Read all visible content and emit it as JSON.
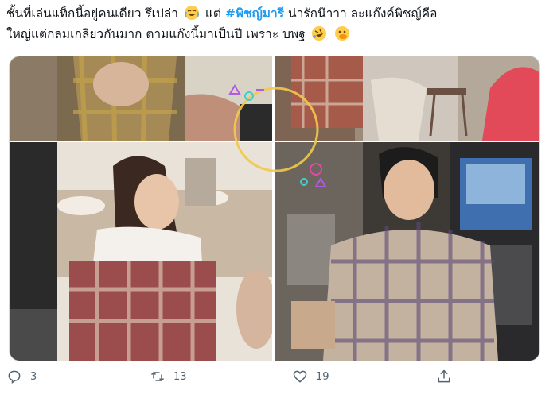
{
  "tweet": {
    "line1_pre": "ชั้นที่เล่นแท็กนี้อยู่คนเดียว รึเปล่า",
    "line1_mid": " แต่ ",
    "hashtag": "#พิชญ์มารี",
    "line1_post": " น่ารักน๊าาา ละแก๊งค์พิชญ์คือ",
    "line2": "ใหญ่แต่กลมเกลียวกันมาก ตามแก๊งนี้มาเป็นปี เพราะ บพฐ",
    "emojis": [
      "joy-emoji",
      "rofl-emoji",
      "hand-over-mouth-emoji"
    ]
  },
  "media": {
    "photos": [
      "party-photo-1",
      "party-photo-2",
      "party-photo-3",
      "party-photo-4"
    ]
  },
  "actions": {
    "reply_count": "3",
    "retweet_count": "13",
    "like_count": "19"
  },
  "colors": {
    "hashtag": "#1d9bf0",
    "muted": "#536471",
    "border": "#cfd9de"
  }
}
